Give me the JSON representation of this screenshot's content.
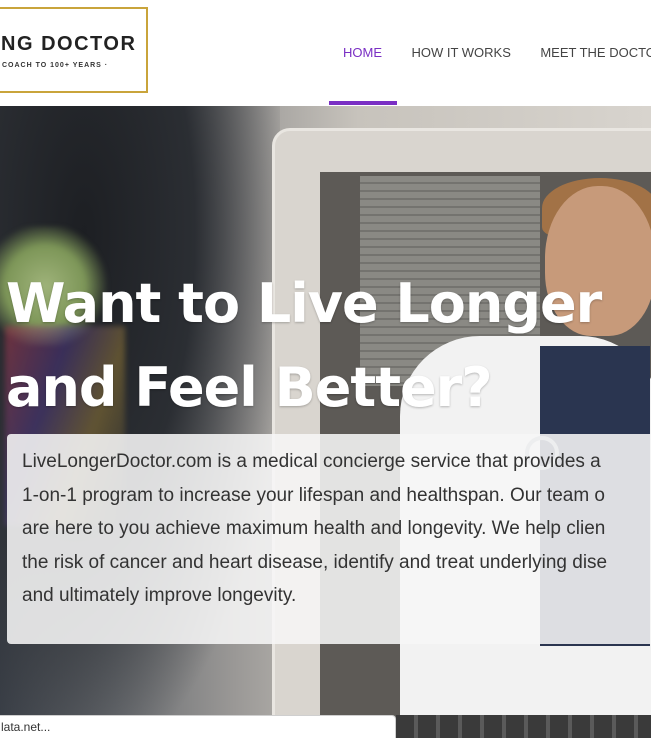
{
  "header": {
    "logo": {
      "main": "ONG DOCTOR",
      "sub": "COACH TO 100+ YEARS ·"
    },
    "nav": [
      {
        "label": "HOME",
        "active": true
      },
      {
        "label": "HOW IT WORKS",
        "active": false
      },
      {
        "label": "MEET THE DOCTO",
        "active": false
      }
    ],
    "accent_color": "#7a2fc4",
    "logo_border_color": "#c9a43b"
  },
  "hero": {
    "title_line1": "Want to Live Longer",
    "title_line2": "and Feel Better?",
    "intro_text": "LiveLongerDoctor.com is a medical concierge service that provides a\n1-on-1 program to increase your lifespan and healthspan. Our team o\nare here to you achieve maximum health and longevity. We help clien\nthe risk of cancer and heart disease, identify and treat underlying dise\nand ultimately improve longevity."
  },
  "statusbar": {
    "text": "lata.net..."
  }
}
